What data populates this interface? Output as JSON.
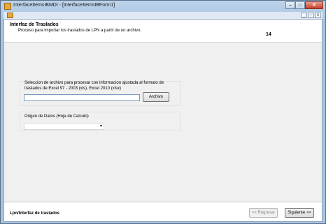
{
  "window": {
    "title": "InterfaceItemsIBMDI - [InterfaceItemsIBForm1]",
    "minimize_glyph": "–",
    "maximize_glyph": "□",
    "close_glyph": "✕"
  },
  "mdi": {
    "minimize_glyph": "_",
    "restore_glyph": "▫",
    "close_glyph": "x"
  },
  "header": {
    "title": "Interfaz de Traslados",
    "subtitle": "Proceso para importar los traslados de LPN a partir de un archivo.",
    "number": "14"
  },
  "file_group": {
    "label": "Seleccion de archivo para procesar con informacion ajustada al formato de traslados de Excel 97 - 2003 (xls), Excel 2010 (xlsx)",
    "file_path_value": "",
    "browse_button_label": "Archivo"
  },
  "source_group": {
    "label": "Origen de Datos (Hoja de Calculo)",
    "selected_value": "",
    "arrow_glyph": "▾"
  },
  "footer": {
    "label": "Lpn/Interfaz de traslados",
    "back_button_label": "<< Regresar",
    "next_button_label": "Siguiente >>"
  }
}
